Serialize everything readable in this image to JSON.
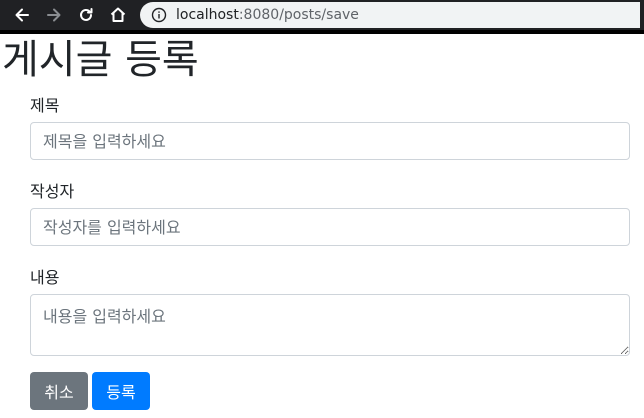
{
  "browser": {
    "url_host": "localhost",
    "url_rest": ":8080/posts/save"
  },
  "page": {
    "title": "게시글 등록"
  },
  "form": {
    "title_label": "제목",
    "title_placeholder": "제목을 입력하세요",
    "author_label": "작성자",
    "author_placeholder": "작성자를 입력하세요",
    "content_label": "내용",
    "content_placeholder": "내용을 입력하세요"
  },
  "buttons": {
    "cancel_label": "취소",
    "submit_label": "등록"
  },
  "colors": {
    "primary": "#007bff",
    "secondary": "#6c757d"
  },
  "icons": [
    "back-arrow-icon",
    "forward-arrow-icon",
    "reload-icon",
    "home-icon",
    "info-icon"
  ]
}
